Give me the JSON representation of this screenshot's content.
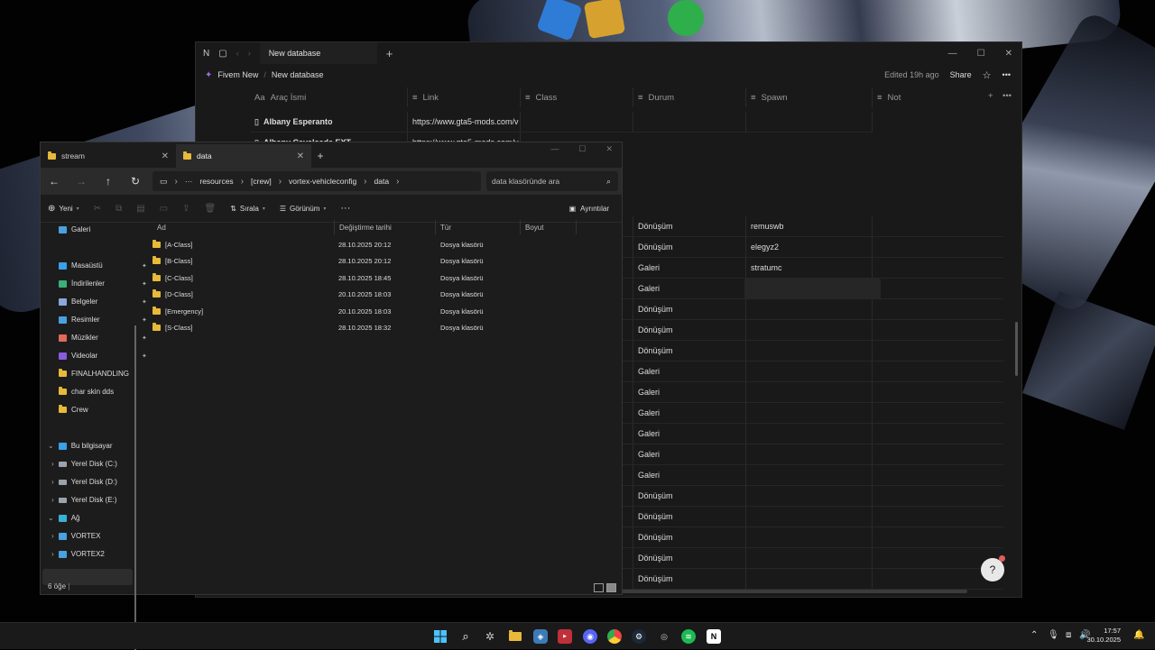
{
  "notion": {
    "tab_title": "New database",
    "workspace": "Fivem New",
    "breadcrumb_page": "New database",
    "edited": "Edited 19h ago",
    "share": "Share",
    "columns": [
      "Araç İsmi",
      "Link",
      "Class",
      "Durum",
      "Spawn",
      "Not"
    ],
    "top_rows": [
      {
        "name": "Albany Esperanto",
        "link": "https://www.gta5-mods.com/v"
      },
      {
        "name": "Albany Cavalcade EXT",
        "link": "https://www.gta5-mods.com/v"
      }
    ],
    "visible_rows": [
      {
        "durum": "Dönüşüm",
        "spawn": "remuswb"
      },
      {
        "durum": "Dönüşüm",
        "spawn": "elegyz2"
      },
      {
        "durum": "Galeri",
        "spawn": "stratumc"
      },
      {
        "durum": "Galeri",
        "spawn": ""
      },
      {
        "durum": "Dönüşüm",
        "spawn": ""
      },
      {
        "durum": "Dönüşüm",
        "spawn": ""
      },
      {
        "durum": "Dönüşüm",
        "spawn": ""
      },
      {
        "durum": "Galeri",
        "spawn": ""
      },
      {
        "durum": "Galeri",
        "spawn": ""
      },
      {
        "durum": "Galeri",
        "spawn": ""
      },
      {
        "durum": "Galeri",
        "spawn": ""
      },
      {
        "durum": "Galeri",
        "spawn": ""
      },
      {
        "durum": "Galeri",
        "spawn": ""
      },
      {
        "durum": "Dönüşüm",
        "spawn": ""
      },
      {
        "durum": "Dönüşüm",
        "spawn": ""
      },
      {
        "durum": "Dönüşüm",
        "spawn": ""
      },
      {
        "durum": "Dönüşüm",
        "spawn": ""
      },
      {
        "durum": "Dönüşüm",
        "spawn": ""
      }
    ],
    "help_label": "?"
  },
  "explorer": {
    "tabs": [
      {
        "title": "stream"
      },
      {
        "title": "data"
      }
    ],
    "address": [
      "resources",
      "[crew]",
      "vortex-vehicleconfig",
      "data"
    ],
    "search_placeholder": "data klasöründe ara",
    "cmd": {
      "new": "Yeni",
      "sort": "Sırala",
      "view": "Görünüm",
      "details": "Ayrıntılar"
    },
    "nav": {
      "gallery": "Galeri",
      "quick": [
        {
          "label": "Masaüstü",
          "color": "#3aa0e8",
          "pinned": true
        },
        {
          "label": "İndirilenler",
          "color": "#3ab07a",
          "pinned": true
        },
        {
          "label": "Belgeler",
          "color": "#8aa8d8",
          "pinned": true
        },
        {
          "label": "Resimler",
          "color": "#4aa0e0",
          "pinned": true
        },
        {
          "label": "Müzikler",
          "color": "#e06a5a",
          "pinned": true
        },
        {
          "label": "Videolar",
          "color": "#8a5ae0",
          "pinned": true
        },
        {
          "label": "FINALHANDLING",
          "color": "#e8b93a",
          "pinned": false
        },
        {
          "label": "char skin dds",
          "color": "#e8b93a",
          "pinned": false
        },
        {
          "label": "Crew",
          "color": "#e8b93a",
          "pinned": false
        }
      ],
      "this_pc": "Bu bilgisayar",
      "drives": [
        "Yerel Disk (C:)",
        "Yerel Disk (D:)",
        "Yerel Disk (E:)"
      ],
      "network": "Ağ",
      "network_items": [
        "VORTEX",
        "VORTEX2"
      ]
    },
    "headers": [
      "Ad",
      "Değiştirme tarihi",
      "Tür",
      "Boyut"
    ],
    "files": [
      {
        "name": "[A-Class]",
        "date": "28.10.2025 20:12",
        "type": "Dosya klasörü"
      },
      {
        "name": "[B-Class]",
        "date": "28.10.2025 20:12",
        "type": "Dosya klasörü"
      },
      {
        "name": "[C-Class]",
        "date": "28.10.2025 18:45",
        "type": "Dosya klasörü"
      },
      {
        "name": "[D-Class]",
        "date": "20.10.2025 18:03",
        "type": "Dosya klasörü"
      },
      {
        "name": "[Emergency]",
        "date": "20.10.2025 18:03",
        "type": "Dosya klasörü"
      },
      {
        "name": "[S-Class]",
        "date": "28.10.2025 18:32",
        "type": "Dosya klasörü"
      }
    ],
    "status": "6 öğe"
  },
  "taskbar": {
    "time": "17:57",
    "date": "30.10.2025",
    "apps": [
      "windows-start-icon",
      "search-icon",
      "bug-app-icon",
      "file-explorer-icon",
      "network-app-icon",
      "video-app-icon",
      "discord-icon",
      "chrome-icon",
      "steam-icon",
      "pen-app-icon",
      "spotify-icon",
      "notion-icon"
    ]
  }
}
